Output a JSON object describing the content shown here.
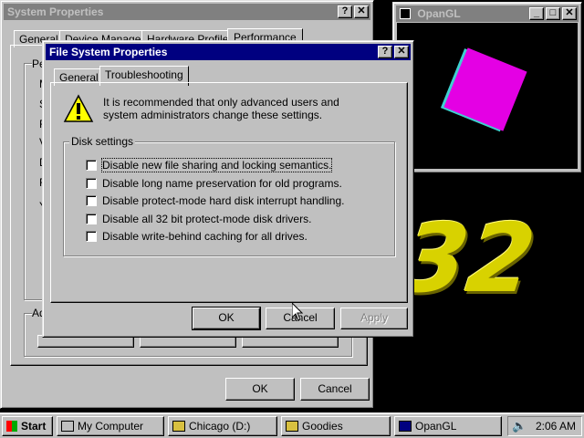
{
  "colors": {
    "desktop": "#000000",
    "accent": "#000080",
    "magenta": "#e400e4",
    "yellow": "#d8d200"
  },
  "sysprops": {
    "title": "System Properties",
    "tabs": [
      "General",
      "Device Manager",
      "Hardware Profiles",
      "Performance"
    ],
    "ok": "OK",
    "cancel": "Cancel",
    "fragments": [
      "Pe",
      "M",
      "S",
      "F",
      "V",
      "D",
      "F",
      "Y",
      "Ad"
    ]
  },
  "opengl": {
    "title": "OpanGL",
    "overlay_text": "32"
  },
  "fsp": {
    "title": "File System Properties",
    "tabs": [
      "General",
      "Troubleshooting"
    ],
    "warning_text": "It is recommended that only advanced users and system administrators change these settings.",
    "group_label": "Disk settings",
    "checkboxes": [
      "Disable new file sharing and locking semantics.",
      "Disable long name preservation for old programs.",
      "Disable protect-mode hard disk interrupt handling.",
      "Disable all 32 bit protect-mode disk drivers.",
      "Disable write-behind caching for all drives."
    ],
    "ok": "OK",
    "cancel": "Cancel",
    "apply": "Apply"
  },
  "taskbar": {
    "start": "Start",
    "items": [
      "My Computer",
      "Chicago (D:)",
      "Goodies",
      "OpanGL"
    ],
    "clock": "2:06 AM"
  }
}
